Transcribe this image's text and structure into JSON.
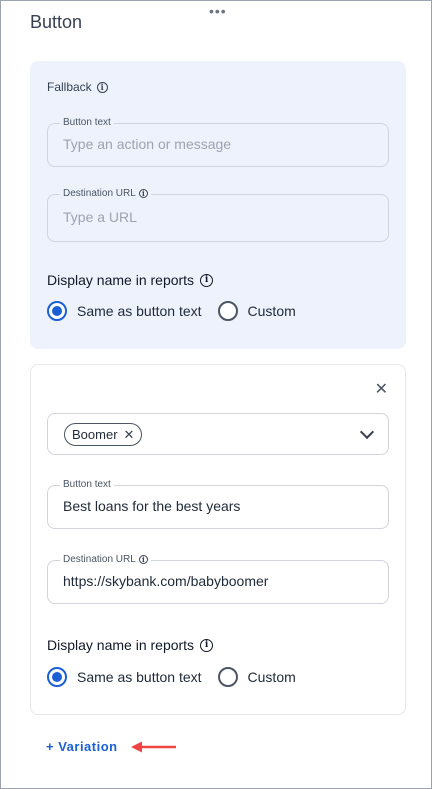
{
  "panel": {
    "title": "Button"
  },
  "fallback": {
    "label": "Fallback",
    "button_text": {
      "label": "Button text",
      "placeholder": "Type an action or message"
    },
    "destination_url": {
      "label": "Destination URL",
      "placeholder": "Type a URL"
    },
    "display_name": {
      "label": "Display name in reports",
      "options": [
        "Same as button text",
        "Custom"
      ],
      "selected": "Same as button text"
    }
  },
  "variation": {
    "segment_chip": "Boomer",
    "button_text": {
      "label": "Button text",
      "value": "Best loans for the best years"
    },
    "destination_url": {
      "label": "Destination URL",
      "value": "https://skybank.com/babyboomer"
    },
    "display_name": {
      "label": "Display name in reports",
      "options": [
        "Same as button text",
        "Custom"
      ],
      "selected": "Same as button text"
    }
  },
  "add_variation_label": "+ Variation",
  "colors": {
    "accent": "#1a5fd6",
    "fallback_bg": "#eef2fd",
    "arrow": "#ef4444"
  },
  "icons": [
    "drag-handle-icon",
    "info-icon",
    "close-icon",
    "chevron-down-icon",
    "chip-remove-icon",
    "arrow-left-icon"
  ]
}
